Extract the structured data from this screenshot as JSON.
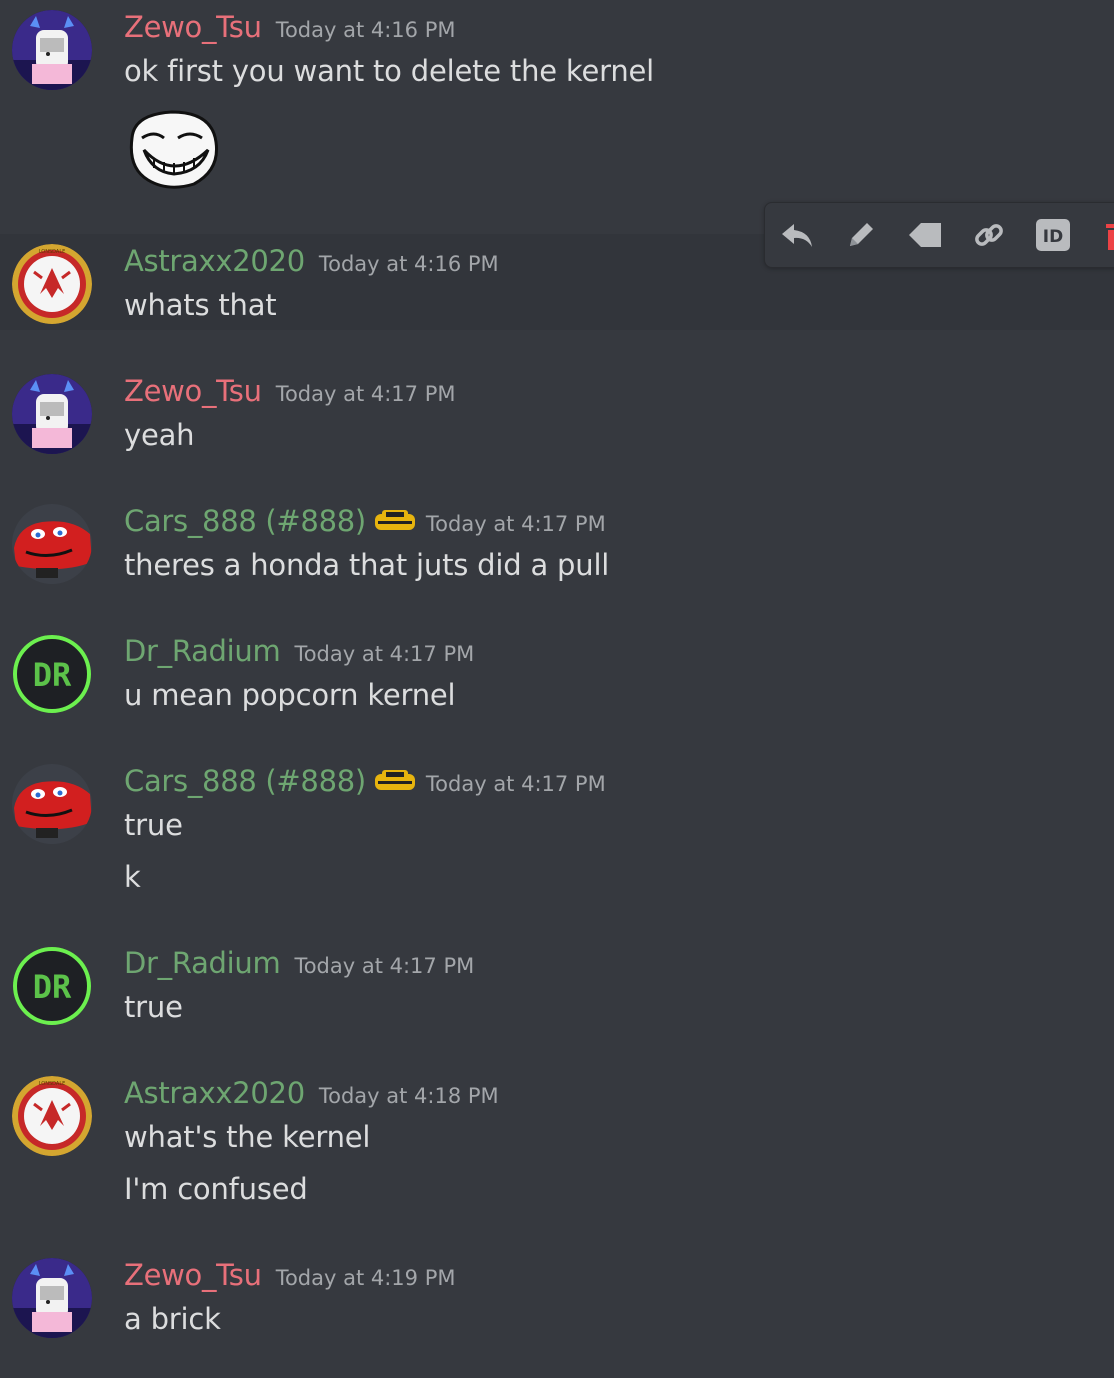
{
  "messages": [
    {
      "username": "Zewo_Tsu",
      "timestamp": "Today at 4:16 PM",
      "lines": [
        "ok first you want to delete the kernel"
      ]
    },
    {
      "username": "Astraxx2020",
      "timestamp": "Today at 4:16 PM",
      "lines": [
        "whats that"
      ]
    },
    {
      "username": "Zewo_Tsu",
      "timestamp": "Today at 4:17 PM",
      "lines": [
        "yeah"
      ]
    },
    {
      "username": "Cars_888 (#888)",
      "timestamp": "Today at 4:17 PM",
      "lines": [
        "theres a honda that juts did a pull"
      ]
    },
    {
      "username": "Dr_Radium",
      "timestamp": "Today at 4:17 PM",
      "lines": [
        "u mean popcorn kernel"
      ]
    },
    {
      "username": "Cars_888 (#888)",
      "timestamp": "Today at 4:17 PM",
      "lines": [
        "true",
        "k"
      ]
    },
    {
      "username": "Dr_Radium",
      "timestamp": "Today at 4:17 PM",
      "lines": [
        "true"
      ]
    },
    {
      "username": "Astraxx2020",
      "timestamp": "Today at 4:18 PM",
      "lines": [
        "what's the kernel",
        "I'm confused"
      ]
    },
    {
      "username": "Zewo_Tsu",
      "timestamp": "Today at 4:19 PM",
      "lines": [
        "a brick"
      ]
    }
  ],
  "avatars": {
    "dr_radium_text": "DR",
    "astraxx_badge_text": "LONSDALE"
  },
  "toolbar_icons": [
    "reply-icon",
    "edit-icon",
    "tag-icon",
    "link-icon",
    "id-icon",
    "trash-icon"
  ],
  "toolbar": {
    "id_label": "ID"
  },
  "colors": {
    "background": "#36393f",
    "hover_background": "#32353b",
    "name_red": "#e8707a",
    "name_green": "#6ea671",
    "text": "#dcddde",
    "timestamp": "#a3a6aa"
  }
}
